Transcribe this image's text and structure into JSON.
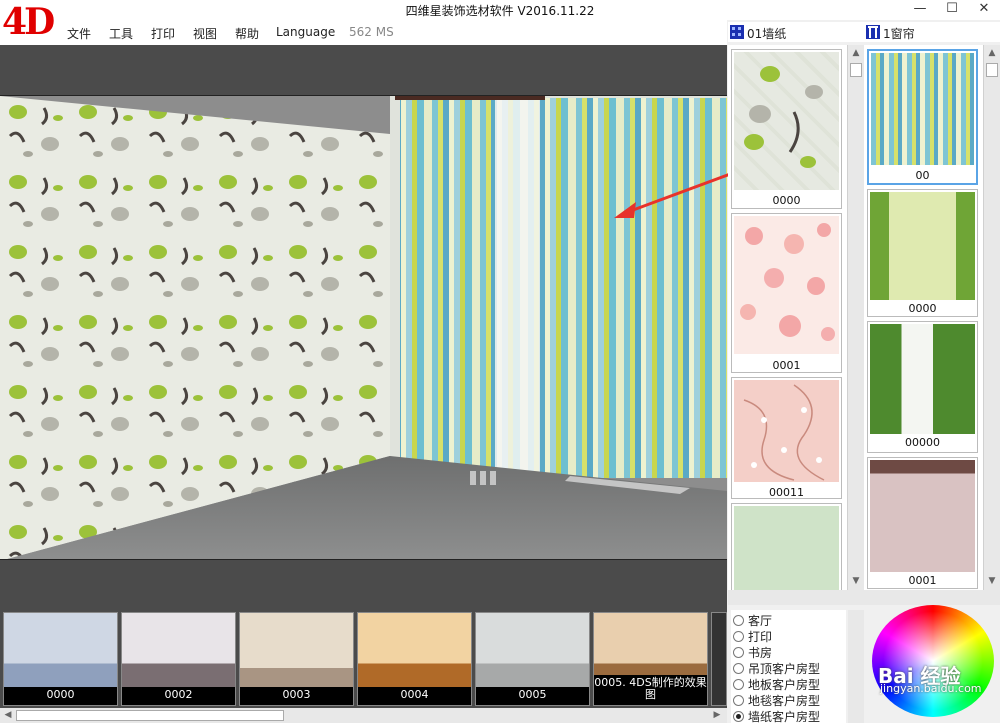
{
  "window": {
    "title": "四维星装饰选材软件  V2016.11.22",
    "minimize": "—",
    "maximize": "☐",
    "close": "✕"
  },
  "app": {
    "logo": "4D",
    "menu": [
      "文件",
      "工具",
      "打印",
      "视图",
      "帮助",
      "Language"
    ],
    "timing": "562 MS"
  },
  "wallpaper_panel": {
    "header": "01墙纸",
    "items": [
      {
        "label": "0000"
      },
      {
        "label": "0001"
      },
      {
        "label": "00011"
      },
      {
        "label": ""
      }
    ]
  },
  "curtain_panel": {
    "header": "1窗帘",
    "items": [
      {
        "label": "00"
      },
      {
        "label": "0000"
      },
      {
        "label": "00000"
      },
      {
        "label": "0001"
      }
    ]
  },
  "room_strip": [
    {
      "label": "0000"
    },
    {
      "label": "0002"
    },
    {
      "label": "0003"
    },
    {
      "label": "0004"
    },
    {
      "label": "0005"
    },
    {
      "label": "0005. 4DS制作的效果图"
    }
  ],
  "room_types": [
    {
      "label": "客厅",
      "selected": false
    },
    {
      "label": "打印",
      "selected": false
    },
    {
      "label": "书房",
      "selected": false
    },
    {
      "label": "吊顶客户房型",
      "selected": false
    },
    {
      "label": "地板客户房型",
      "selected": false
    },
    {
      "label": "地毯客户房型",
      "selected": false
    },
    {
      "label": "墙纸客户房型",
      "selected": true
    }
  ],
  "watermark": {
    "brand": "Bai 经验",
    "url": "jingyan.baidu.com"
  },
  "colors": {
    "logo": "#e00000",
    "viewport_bg": "#4b4b4b",
    "arrow": "#e8322a"
  }
}
